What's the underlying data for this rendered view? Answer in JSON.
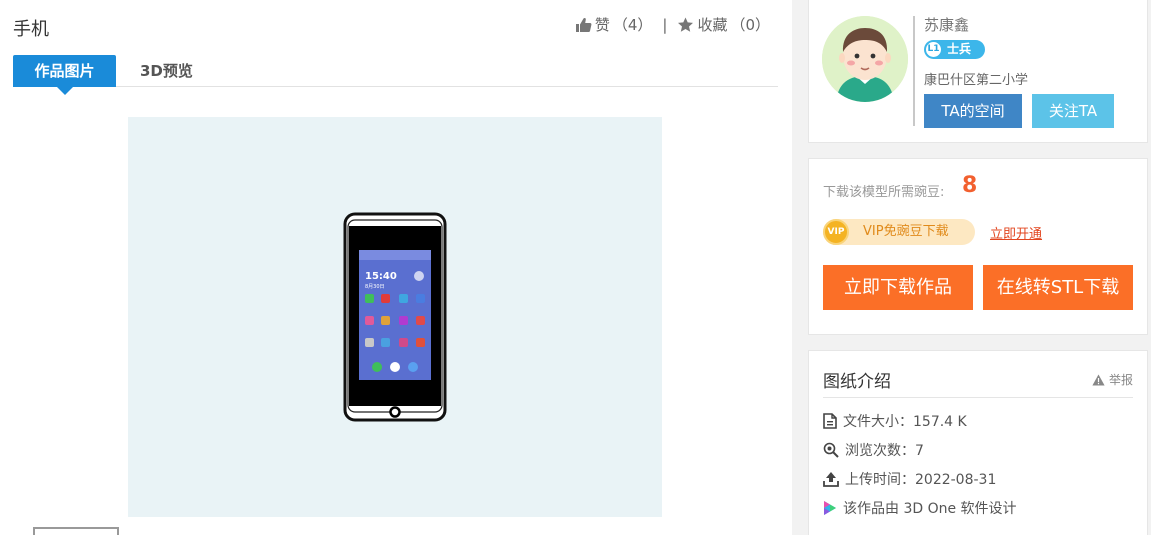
{
  "work": {
    "title": "手机",
    "like_label": "赞",
    "like_count": "（4）",
    "separator": "|",
    "collect_label": "收藏",
    "collect_count": "（0）"
  },
  "tabs": [
    {
      "label": "作品图片",
      "active": true
    },
    {
      "label": "3D预览",
      "active": false
    }
  ],
  "phone_screen": {
    "time": "15:40",
    "date": "8月30日"
  },
  "author": {
    "name": "苏康鑫",
    "level": "L1",
    "rank": "士兵",
    "school": "康巴什区第二小学",
    "space_button": "TA的空间",
    "follow_button": "关注TA"
  },
  "download": {
    "need_label": "下载该模型所需豌豆:",
    "need_value": "8",
    "vip_icon_text": "VIP",
    "vip_text": "VIP免豌豆下载",
    "open_link": "立即开通",
    "download_button": "立即下载作品",
    "stl_button": "在线转STL下载"
  },
  "info": {
    "title": "图纸介绍",
    "report": "举报",
    "file_size": "文件大小：157.4 K",
    "views": "浏览次数：7",
    "upload_time": "上传时间：2022-08-31",
    "software": "该作品由 3D One 软件设计"
  },
  "colors": {
    "accent_blue": "#1a8bd9",
    "orange": "#fb6f27",
    "space_button": "#3f86c6",
    "follow_button": "#5cc3e8"
  }
}
